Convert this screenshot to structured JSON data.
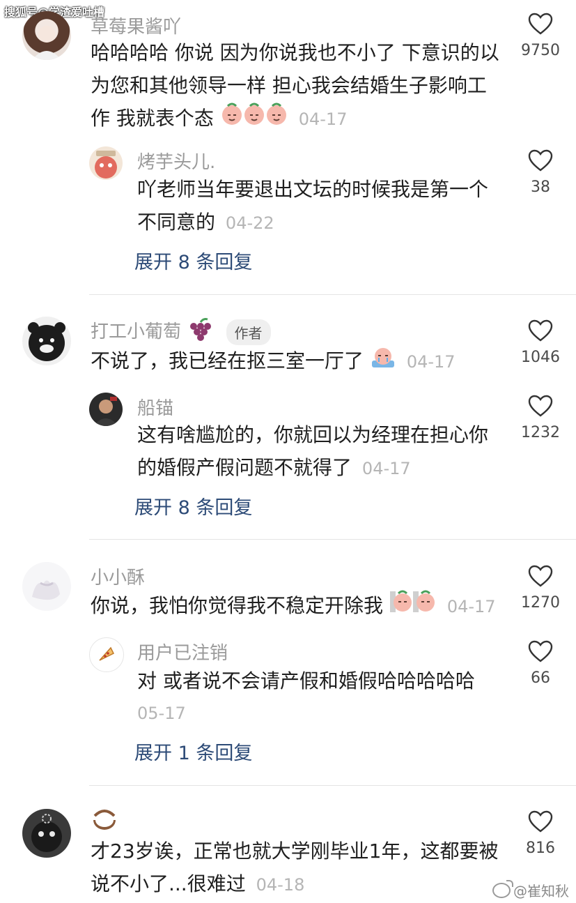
{
  "watermark_top": "搜狐号@学渣爱吐槽",
  "watermark_bottom": "@崔知秋",
  "comments": [
    {
      "username": "草莓果酱吖",
      "text": "哈哈哈哈 你说 因为你说我也不小了 下意识的以为您和其他领导一样 担心我会结婚生子影响工作 我就表个态",
      "date": "04-17",
      "likes": "9750",
      "emoji": "peach-face-emoji",
      "reply": {
        "username": "烤芋头儿.",
        "text": "吖老师当年要退出文坛的时候我是第一个不同意的",
        "date": "04-22",
        "likes": "38"
      },
      "expand": "展开 8 条回复"
    },
    {
      "username": "打工小葡萄",
      "badge": "作者",
      "text": "不说了，我已经在抠三室一厅了",
      "date": "04-17",
      "likes": "1046",
      "reply": {
        "username": "船锚",
        "text": "这有啥尴尬的，你就回以为经理在担心你的婚假产假问题不就得了",
        "date": "04-17",
        "likes": "1232"
      },
      "expand": "展开 8 条回复"
    },
    {
      "username": "小小酥",
      "text": "你说，我怕你觉得我不稳定开除我",
      "date": "04-17",
      "likes": "1270",
      "reply": {
        "username": "用户已注销",
        "text": "对 或者说不会请产假和婚假哈哈哈哈哈",
        "date": "05-17",
        "likes": "66"
      },
      "expand": "展开 1 条回复"
    },
    {
      "username": "",
      "text": "才23岁诶，正常也就大学刚毕业1年，这都要被说不小了...很难过",
      "date": "04-18",
      "likes": "816"
    }
  ],
  "colors": {
    "link": "#2d4b77",
    "username": "#9a9a9a",
    "date": "#b5b5b5"
  }
}
